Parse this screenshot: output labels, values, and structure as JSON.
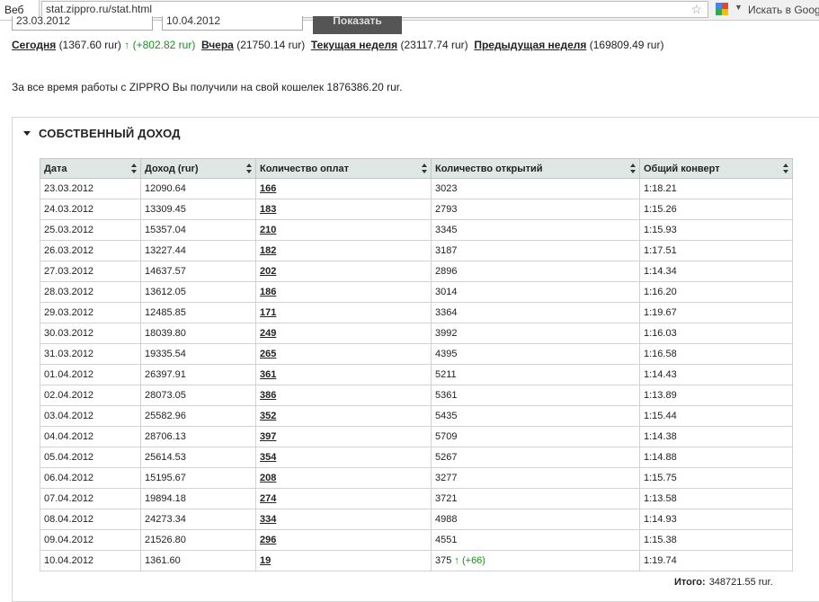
{
  "browser": {
    "tab_label": "Веб",
    "url": "stat.zippro.ru/stat.html",
    "search_placeholder": "Искать в Goog"
  },
  "form": {
    "date_from": "23.03.2012",
    "date_to": "10.04.2012",
    "show_button": "Показать"
  },
  "stats": {
    "today_label": "Сегодня",
    "today_value": "(1367.60 rur)",
    "today_delta": "↑ (+802.82 rur)",
    "yesterday_label": "Вчера",
    "yesterday_value": "(21750.14 rur)",
    "current_week_label": "Текущая неделя",
    "current_week_value": "(23117.74 rur)",
    "prev_week_label": "Предыдущая неделя",
    "prev_week_value": "(169809.49 rur)"
  },
  "summary": "За все время работы с ZIPPRO Вы получили на свой кошелек 1876386.20 rur.",
  "panel": {
    "title": "СОБСТВЕННЫЙ ДОХОД",
    "columns": [
      "Дата",
      "Доход (rur)",
      "Количество оплат",
      "Количество открытий",
      "Общий конверт"
    ],
    "rows": [
      [
        "23.03.2012",
        "12090.64",
        "166",
        "3023",
        "1:18.21"
      ],
      [
        "24.03.2012",
        "13309.45",
        "183",
        "2793",
        "1:15.26"
      ],
      [
        "25.03.2012",
        "15357.04",
        "210",
        "3345",
        "1:15.93"
      ],
      [
        "26.03.2012",
        "13227.44",
        "182",
        "3187",
        "1:17.51"
      ],
      [
        "27.03.2012",
        "14637.57",
        "202",
        "2896",
        "1:14.34"
      ],
      [
        "28.03.2012",
        "13612.05",
        "186",
        "3014",
        "1:16.20"
      ],
      [
        "29.03.2012",
        "12485.85",
        "171",
        "3364",
        "1:19.67"
      ],
      [
        "30.03.2012",
        "18039.80",
        "249",
        "3992",
        "1:16.03"
      ],
      [
        "31.03.2012",
        "19335.54",
        "265",
        "4395",
        "1:16.58"
      ],
      [
        "01.04.2012",
        "26397.91",
        "361",
        "5211",
        "1:14.43"
      ],
      [
        "02.04.2012",
        "28073.05",
        "386",
        "5361",
        "1:13.89"
      ],
      [
        "03.04.2012",
        "25582.96",
        "352",
        "5435",
        "1:15.44"
      ],
      [
        "04.04.2012",
        "28706.13",
        "397",
        "5709",
        "1:14.38"
      ],
      [
        "05.04.2012",
        "25614.53",
        "354",
        "5267",
        "1:14.88"
      ],
      [
        "06.04.2012",
        "15195.67",
        "208",
        "3277",
        "1:15.75"
      ],
      [
        "07.04.2012",
        "19894.18",
        "274",
        "3721",
        "1:13.58"
      ],
      [
        "08.04.2012",
        "24273.34",
        "334",
        "4988",
        "1:14.93"
      ],
      [
        "09.04.2012",
        "21526.80",
        "296",
        "4551",
        "1:15.38"
      ],
      [
        "10.04.2012",
        "1361.60",
        "19",
        "375",
        "1:19.74"
      ]
    ],
    "last_row_open_delta": "↑ (+66)",
    "total_label": "Итого:",
    "total_value": "348721.55 rur."
  },
  "colors": {
    "header_bg": "#dfe7e5",
    "delta_green": "#1b8f1b"
  }
}
